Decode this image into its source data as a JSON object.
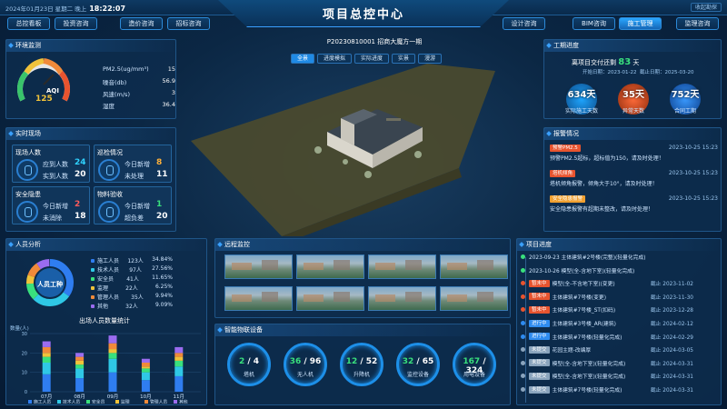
{
  "header": {
    "datetime": "2024年01月23日 星期二 晚上",
    "time": "18:22:07",
    "title": "项目总控中心",
    "login": "收起勘探"
  },
  "nav_left": [
    "总控看板",
    "投资咨询",
    "造价咨询",
    "招标咨询"
  ],
  "nav_right": [
    "设计咨询",
    "BIM咨询",
    "施工管理",
    "监理咨询"
  ],
  "nav_active": "施工管理",
  "center": {
    "project": "P20230810001 招商大魔方一期",
    "tabs": [
      "全景",
      "进度模拟",
      "实际进度",
      "实景",
      "漫游"
    ],
    "active_tab": "全景"
  },
  "env": {
    "title": "环境监测",
    "aqi_value": "125",
    "aqi_label": "AQI",
    "rows": [
      {
        "k": "PM2.5(ug/mm³)",
        "v": "15"
      },
      {
        "k": "噪音(db)",
        "v": "56.9"
      },
      {
        "k": "风速(m/s)",
        "v": "3"
      },
      {
        "k": "湿度",
        "v": "36.4"
      }
    ]
  },
  "site": {
    "title": "实时现场",
    "personnel": {
      "title": "现场人数",
      "a_label": "应到人数",
      "a": "24",
      "b_label": "实到人数",
      "b": "20"
    },
    "inspect": {
      "title": "巡检情况",
      "a_label": "今日新增",
      "a": "8",
      "b_label": "未处理",
      "b": "11"
    },
    "safety": {
      "title": "安全隐患",
      "a_label": "今日新增",
      "a": "2",
      "b_label": "未消除",
      "b": "18"
    },
    "material": {
      "title": "物料验收",
      "a_label": "今日新增",
      "a": "1",
      "b_label": "超负差",
      "b": "20"
    }
  },
  "people": {
    "title": "人员分析",
    "donut_label": "人员工种",
    "rows": [
      {
        "name": "施工人员",
        "n": "123人",
        "p": "34.84%",
        "c": "#2f7df0"
      },
      {
        "name": "技术人员",
        "n": "97人",
        "p": "27.56%",
        "c": "#2fc8e6"
      },
      {
        "name": "安全员",
        "n": "41人",
        "p": "11.65%",
        "c": "#39e07d"
      },
      {
        "name": "监理",
        "n": "22人",
        "p": "6.25%",
        "c": "#f0c23a"
      },
      {
        "name": "管理人员",
        "n": "35人",
        "p": "9.94%",
        "c": "#f08a3a"
      },
      {
        "name": "其他",
        "n": "32人",
        "p": "9.09%",
        "c": "#9b6cf0"
      }
    ]
  },
  "chart_data": {
    "type": "bar",
    "title": "出场人员数量统计",
    "ylabel": "数量(人)",
    "categories": [
      "07月",
      "08月",
      "09月",
      "10月",
      "11月"
    ],
    "series": [
      {
        "name": "施工人员",
        "values": [
          9,
          7,
          10,
          6,
          8
        ]
      },
      {
        "name": "技术人员",
        "values": [
          6,
          5,
          7,
          4,
          5
        ]
      },
      {
        "name": "安全员",
        "values": [
          3,
          2,
          3,
          2,
          3
        ]
      },
      {
        "name": "监理",
        "values": [
          2,
          2,
          2,
          1,
          2
        ]
      },
      {
        "name": "管理人员",
        "values": [
          3,
          2,
          3,
          2,
          2
        ]
      },
      {
        "name": "其他",
        "values": [
          3,
          2,
          4,
          2,
          3
        ]
      }
    ],
    "ylim": [
      0,
      30
    ]
  },
  "period": {
    "title": "工期进度",
    "line": "离项目交付还剩",
    "days": "83",
    "unit": "天",
    "start_label": "开始日期：",
    "start": "2023-01-22",
    "end_label": "截止日期：",
    "end": "2025-03-20",
    "stats": [
      {
        "v": "634天",
        "l": "实际施工天数"
      },
      {
        "v": "35天",
        "l": "异常天数"
      },
      {
        "v": "752天",
        "l": "合同工期"
      }
    ]
  },
  "alerts": {
    "title": "报警情况",
    "items": [
      {
        "tag": "预警PM2.5",
        "color": "#e8542f",
        "time": "2023-10-25 15:23",
        "text": "预警PM2.5超标，超标值为150，请及时处理！"
      },
      {
        "tag": "塔机倾角",
        "color": "#e8542f",
        "time": "2023-10-25 15:23",
        "text": "塔机倾角报警，倾角大于10°，请及时处理！"
      },
      {
        "tag": "安全隐患报警",
        "color": "#f0a030",
        "time": "2023-10-25 15:23",
        "text": "安全隐患报警有超期未整改，请及时处理！"
      }
    ]
  },
  "video": {
    "title": "远程监控"
  },
  "devices": {
    "title": "智能物联设备",
    "items": [
      {
        "a": "2",
        "b": "4",
        "l": "塔机"
      },
      {
        "a": "36",
        "b": "96",
        "l": "无人机"
      },
      {
        "a": "12",
        "b": "52",
        "l": "升降机"
      },
      {
        "a": "32",
        "b": "65",
        "l": "监控设备"
      },
      {
        "a": "167",
        "b": "324",
        "l": "用电设备"
      }
    ]
  },
  "progress": {
    "title": "项目进度",
    "items": [
      {
        "tag": "",
        "color": "#39e07d",
        "text": "2023-09-23  主体建筑#2号楼(完整)(轻量化完成)",
        "date": ""
      },
      {
        "tag": "",
        "color": "#39e07d",
        "text": "2023-10-26  模型(全-含地下室)(轻量化完成)",
        "date": ""
      },
      {
        "tag": "暂未中",
        "color": "#e8542f",
        "text": "模型(全-不含地下室)(变更)",
        "date": "截止 2023-11-02"
      },
      {
        "tag": "暂未中",
        "color": "#e8542f",
        "text": "主体建筑#7号楼(变更)",
        "date": "截止 2023-11-30"
      },
      {
        "tag": "暂未中",
        "color": "#e8542f",
        "text": "主体建筑#7号楼_ST(扣码)",
        "date": "截止 2023-12-28"
      },
      {
        "tag": "进行中",
        "color": "#2f8cf0",
        "text": "主体建筑#3号楼_AR(建筑)",
        "date": "截止 2024-02-12"
      },
      {
        "tag": "进行中",
        "color": "#2f8cf0",
        "text": "主体建筑#7号楼(轻量化完成)",
        "date": "截止 2024-02-29"
      },
      {
        "tag": "未提交",
        "color": "#8aa4bd",
        "text": "花园主题-改编厚",
        "date": "截止 2024-03-05"
      },
      {
        "tag": "未提交",
        "color": "#8aa4bd",
        "text": "模型(全-含地下室)(轻量化完成)",
        "date": "截止 2024-03-31"
      },
      {
        "tag": "未提交",
        "color": "#8aa4bd",
        "text": "模型(全-含地下室)(轻量化完成)",
        "date": "截止 2024-03-31"
      },
      {
        "tag": "未提交",
        "color": "#8aa4bd",
        "text": "主体建筑#7号楼(轻量化完成)",
        "date": "截止 2024-03-31"
      }
    ]
  }
}
